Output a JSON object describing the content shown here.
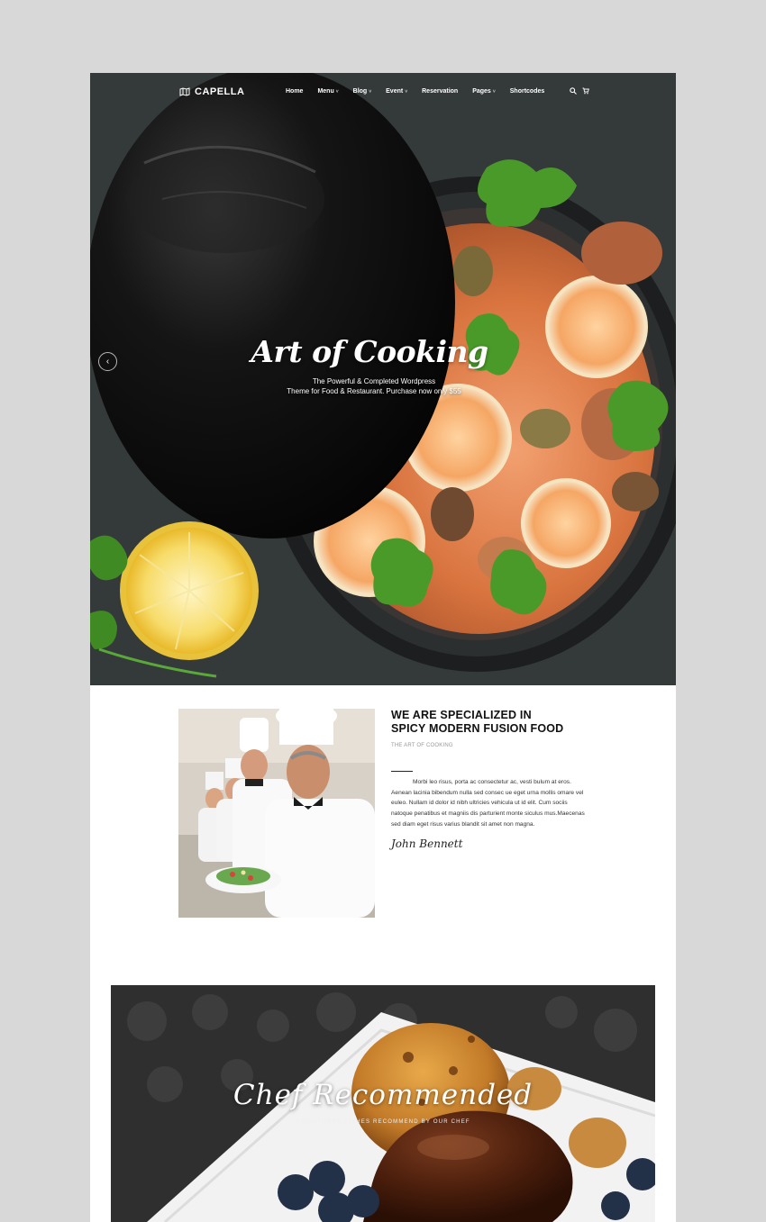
{
  "header": {
    "logo_text": "CAPELLA",
    "logo_icon": "map-icon",
    "menu": [
      {
        "label": "Home",
        "has_dropdown": false
      },
      {
        "label": "Menu",
        "has_dropdown": true
      },
      {
        "label": "Blog",
        "has_dropdown": true
      },
      {
        "label": "Event",
        "has_dropdown": true
      },
      {
        "label": "Reservation",
        "has_dropdown": false
      },
      {
        "label": "Pages",
        "has_dropdown": true
      },
      {
        "label": "Shortcodes",
        "has_dropdown": false
      }
    ],
    "caret": "˅",
    "icons": [
      "search-icon",
      "cart-icon"
    ]
  },
  "hero": {
    "title": "Art of Cooking",
    "subtitle_line1": "The Powerful & Completed Wordpress",
    "subtitle_line2": "Theme for Food & Restaurant. Purchase now only $55",
    "prev_arrow": "‹"
  },
  "about": {
    "heading_line1": "WE ARE SPECIALIZED IN",
    "heading_line2": "SPICY MODERN FUSION FOOD",
    "kicker": "THE ART OF COOKING",
    "body": "Morbi leo risus, porta ac consectetur ac, vesti bulum at eros. Aenean lacinia bibendum nulla sed consec ue eget urna mollis omare vel euleo. Nullam id dolor id nibh ultricies vehicula ut id elit. Cum sociis natoque penatibus et magniis dis parturient monte siculus mus.Maecenas sed diam eget risus varius blandit sit amet non magna.",
    "signature": "John Bennett"
  },
  "recommended": {
    "title": "Chef Recommended",
    "subtitle": "SIGNATURES DISHES RECOMMEND BY OUR CHEF"
  },
  "colors": {
    "page_bg": "#d8d8d8",
    "text_dark": "#111111",
    "accent_orange": "#e8814a"
  }
}
